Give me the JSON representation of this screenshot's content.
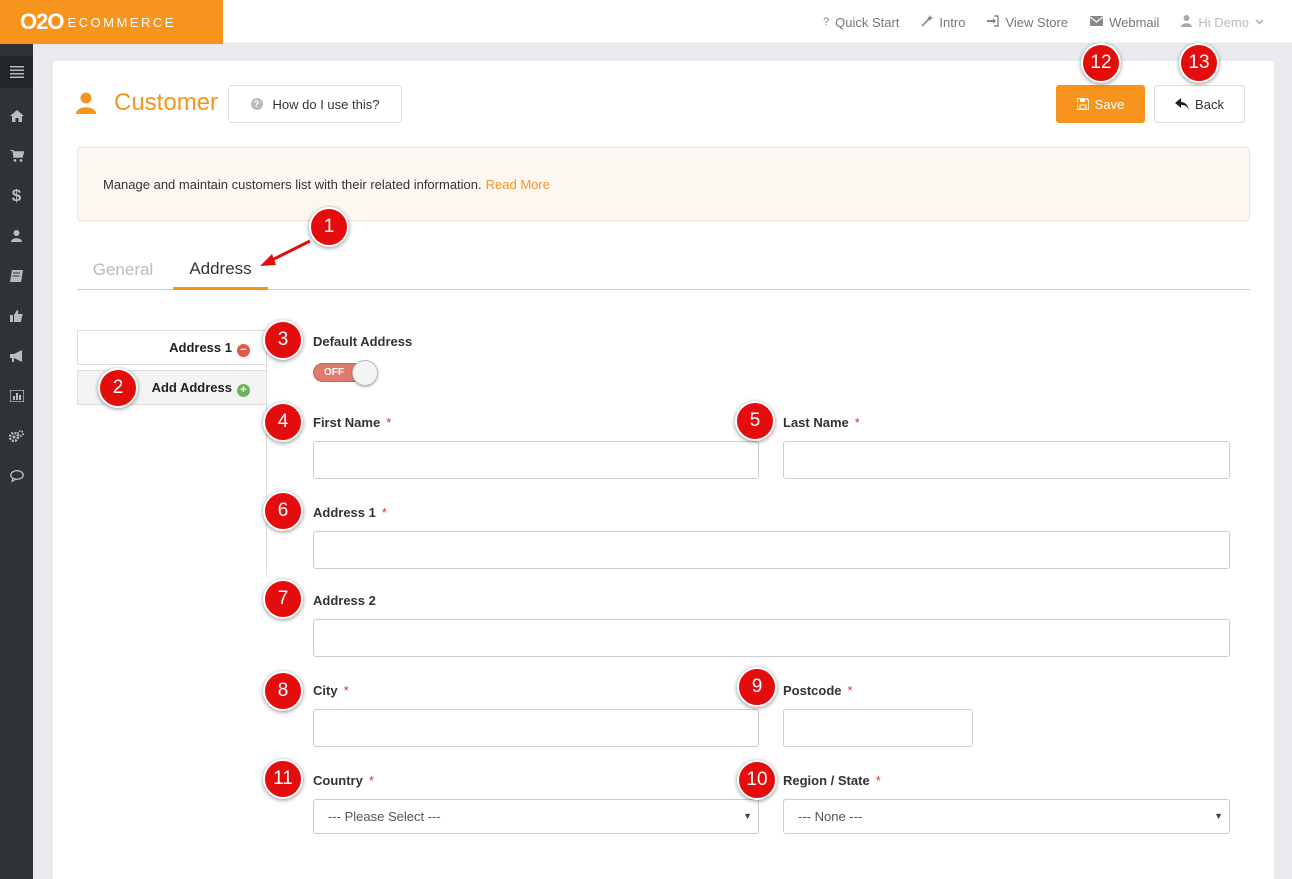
{
  "brand": {
    "part1": "O2O",
    "part2": "ECOMMERCE"
  },
  "topnav": [
    {
      "icon": "question-icon",
      "label": "Quick Start"
    },
    {
      "icon": "wand-icon",
      "label": "Intro"
    },
    {
      "icon": "sign-in-icon",
      "label": "View Store"
    },
    {
      "icon": "envelope-icon",
      "label": "Webmail"
    },
    {
      "icon": "user-icon",
      "label": "Hi Demo"
    }
  ],
  "sidebar": [
    "menu-icon",
    "home-icon",
    "cart-icon",
    "dollar-icon",
    "user-icon",
    "book-icon",
    "thumbs-up-icon",
    "bullhorn-icon",
    "bar-chart-icon",
    "cogs-icon",
    "comment-icon"
  ],
  "page": {
    "title": "Customer",
    "help_label": "How do I use this?",
    "save_label": "Save",
    "back_label": "Back"
  },
  "info": {
    "text": "Manage and maintain customers list with their related information.",
    "link": "Read More"
  },
  "tabs": [
    {
      "label": "General"
    },
    {
      "label": "Address"
    }
  ],
  "address_list": {
    "item": "Address 1",
    "add": "Add Address"
  },
  "form": {
    "default_address": {
      "label": "Default Address",
      "toggle": "OFF"
    },
    "first_name": {
      "label": "First Name",
      "value": ""
    },
    "last_name": {
      "label": "Last Name",
      "value": ""
    },
    "address1": {
      "label": "Address 1",
      "value": ""
    },
    "address2": {
      "label": "Address 2",
      "value": ""
    },
    "city": {
      "label": "City",
      "value": ""
    },
    "postcode": {
      "label": "Postcode",
      "value": ""
    },
    "country": {
      "label": "Country",
      "selected": "--- Please Select ---"
    },
    "region": {
      "label": "Region / State",
      "selected": "--- None ---"
    },
    "required_mark": "*"
  },
  "markers": [
    "1",
    "2",
    "3",
    "4",
    "5",
    "6",
    "7",
    "8",
    "9",
    "10",
    "11",
    "12",
    "13"
  ],
  "colors": {
    "accent": "#f7941d",
    "marker": "#e40d0d",
    "sidebar": "#2f3337",
    "required": "#d9342b"
  }
}
